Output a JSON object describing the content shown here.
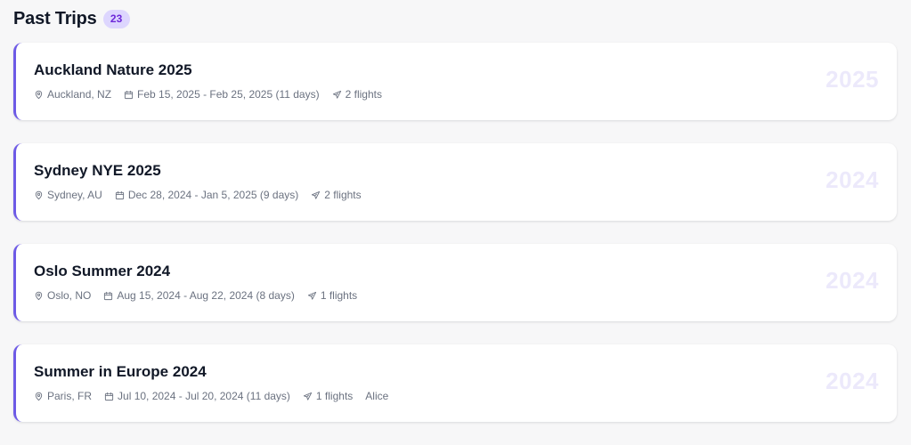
{
  "header": {
    "title": "Past Trips",
    "count": "23"
  },
  "colors": {
    "accent": "#6d5ae6",
    "badge_bg": "#ddd6fe",
    "badge_text": "#6d28d9",
    "watermark": "#ece9fb"
  },
  "icons": {
    "location": "map-pin-icon",
    "dates": "calendar-icon",
    "flights": "plane-icon"
  },
  "trips": [
    {
      "title": "Auckland Nature 2025",
      "location": "Auckland, NZ",
      "dates": "Feb 15, 2025 - Feb 25, 2025 (11 days)",
      "flights": "2 flights",
      "traveler": "",
      "year": "2025"
    },
    {
      "title": "Sydney NYE 2025",
      "location": "Sydney, AU",
      "dates": "Dec 28, 2024 - Jan 5, 2025 (9 days)",
      "flights": "2 flights",
      "traveler": "",
      "year": "2024"
    },
    {
      "title": "Oslo Summer 2024",
      "location": "Oslo, NO",
      "dates": "Aug 15, 2024 - Aug 22, 2024 (8 days)",
      "flights": "1 flights",
      "traveler": "",
      "year": "2024"
    },
    {
      "title": "Summer in Europe 2024",
      "location": "Paris, FR",
      "dates": "Jul 10, 2024 - Jul 20, 2024 (11 days)",
      "flights": "1 flights",
      "traveler": "Alice",
      "year": "2024"
    }
  ]
}
